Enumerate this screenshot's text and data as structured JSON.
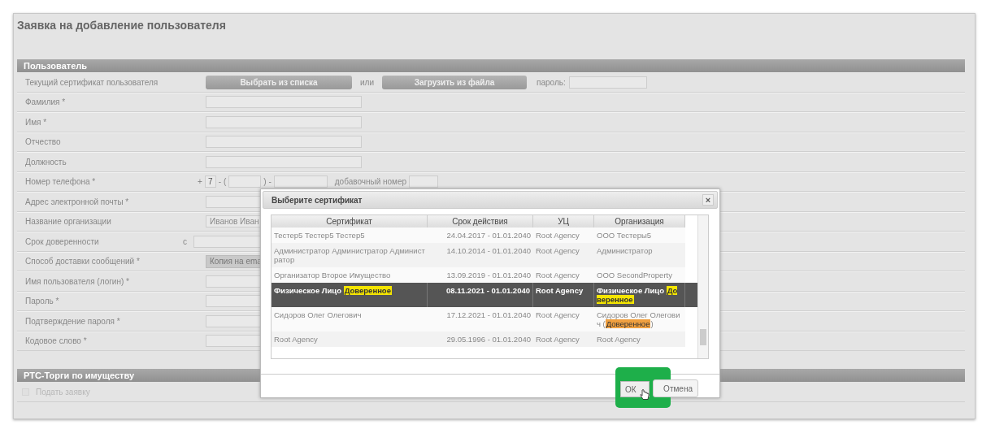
{
  "page": {
    "title": "Заявка на добавление пользователя"
  },
  "user_section": {
    "title": "Пользователь",
    "rows": [
      {
        "kind": "certificate",
        "label": "Текущий сертификат пользователя",
        "choose_button": "Выбрать из списка",
        "or": "или",
        "upload_button": "Загрузить из файла",
        "password_label": "пароль:"
      },
      {
        "kind": "text",
        "label": "Фамилия *"
      },
      {
        "kind": "text",
        "label": "Имя *"
      },
      {
        "kind": "text",
        "label": "Отчество"
      },
      {
        "kind": "text",
        "label": "Должность"
      },
      {
        "kind": "phone",
        "label": "Номер телефона *",
        "plus": "+",
        "code": "7",
        "open": "- (",
        "close": ") -",
        "extension_label": "добавочный номер"
      },
      {
        "kind": "text",
        "label": "Адрес электронной почты *"
      },
      {
        "kind": "text",
        "label": "Название организации",
        "value": "Иванов Иван"
      },
      {
        "kind": "date",
        "label": "Срок доверенности",
        "prefix": "с"
      },
      {
        "kind": "select",
        "label": "Способ доставки сообщений *",
        "value": "Копия на ema"
      },
      {
        "kind": "text",
        "label": "Имя пользователя (логин) *"
      },
      {
        "kind": "text",
        "label": "Пароль *"
      },
      {
        "kind": "text",
        "label": "Подтверждение пароля *"
      },
      {
        "kind": "text",
        "label": "Кодовое слово *"
      }
    ]
  },
  "property_section": {
    "title": "РТС-Торги по имуществу",
    "checkbox": {
      "label": "Подать заявку",
      "checked": false,
      "disabled": true
    }
  },
  "certificate_dialog": {
    "title": "Выберите сертификат",
    "close": "×",
    "columns": [
      "Сертификат",
      "Срок действия",
      "УЦ",
      "Организация"
    ],
    "rows": [
      {
        "selected": false,
        "cells": [
          [
            {
              "text": "Тестер5 Тестер5 Тестер5"
            }
          ],
          [
            {
              "text": "24.04.2017 - 01.01.2040"
            }
          ],
          [
            {
              "text": "Root Agency"
            }
          ],
          [
            {
              "text": "ООО Тестеры5"
            }
          ]
        ]
      },
      {
        "selected": false,
        "cells": [
          [
            {
              "text": "Администратор Администратор Администратор"
            }
          ],
          [
            {
              "text": "14.10.2014 - 01.01.2040"
            }
          ],
          [
            {
              "text": "Root Agency"
            }
          ],
          [
            {
              "text": "Администратор"
            }
          ]
        ]
      },
      {
        "selected": false,
        "cells": [
          [
            {
              "text": "Организатор Второе Имущество"
            }
          ],
          [
            {
              "text": "13.09.2019 - 01.01.2040"
            }
          ],
          [
            {
              "text": "Root Agency"
            }
          ],
          [
            {
              "text": "ООО SecondProperty"
            }
          ]
        ]
      },
      {
        "selected": true,
        "cells": [
          [
            {
              "text": "Физическое Лицо "
            },
            {
              "text": "Доверенное",
              "color": "#f5e600"
            }
          ],
          [
            {
              "text": "08.11.2021 - 01.01.2040"
            }
          ],
          [
            {
              "text": "Root Agency"
            }
          ],
          [
            {
              "text": "Физическое Лицо "
            },
            {
              "text": "Доверенное",
              "color": "#f5e600"
            }
          ]
        ]
      },
      {
        "selected": false,
        "cells": [
          [
            {
              "text": "Сидоров Олег Олегович"
            }
          ],
          [
            {
              "text": "17.12.2021 - 01.01.2040"
            }
          ],
          [
            {
              "text": "Root Agency"
            }
          ],
          [
            {
              "text": "Сидоров Олег Олегович ("
            },
            {
              "text": "Доверенное",
              "color": "#f0a040"
            },
            {
              "text": ")"
            }
          ]
        ]
      },
      {
        "selected": false,
        "cells": [
          [
            {
              "text": "Root Agency"
            }
          ],
          [
            {
              "text": "29.05.1996 - 01.01.2040"
            }
          ],
          [
            {
              "text": "Root Agency"
            }
          ],
          [
            {
              "text": "Root Agency"
            }
          ]
        ]
      }
    ],
    "ok_button": "ОК",
    "cancel_button": "Отмена"
  }
}
